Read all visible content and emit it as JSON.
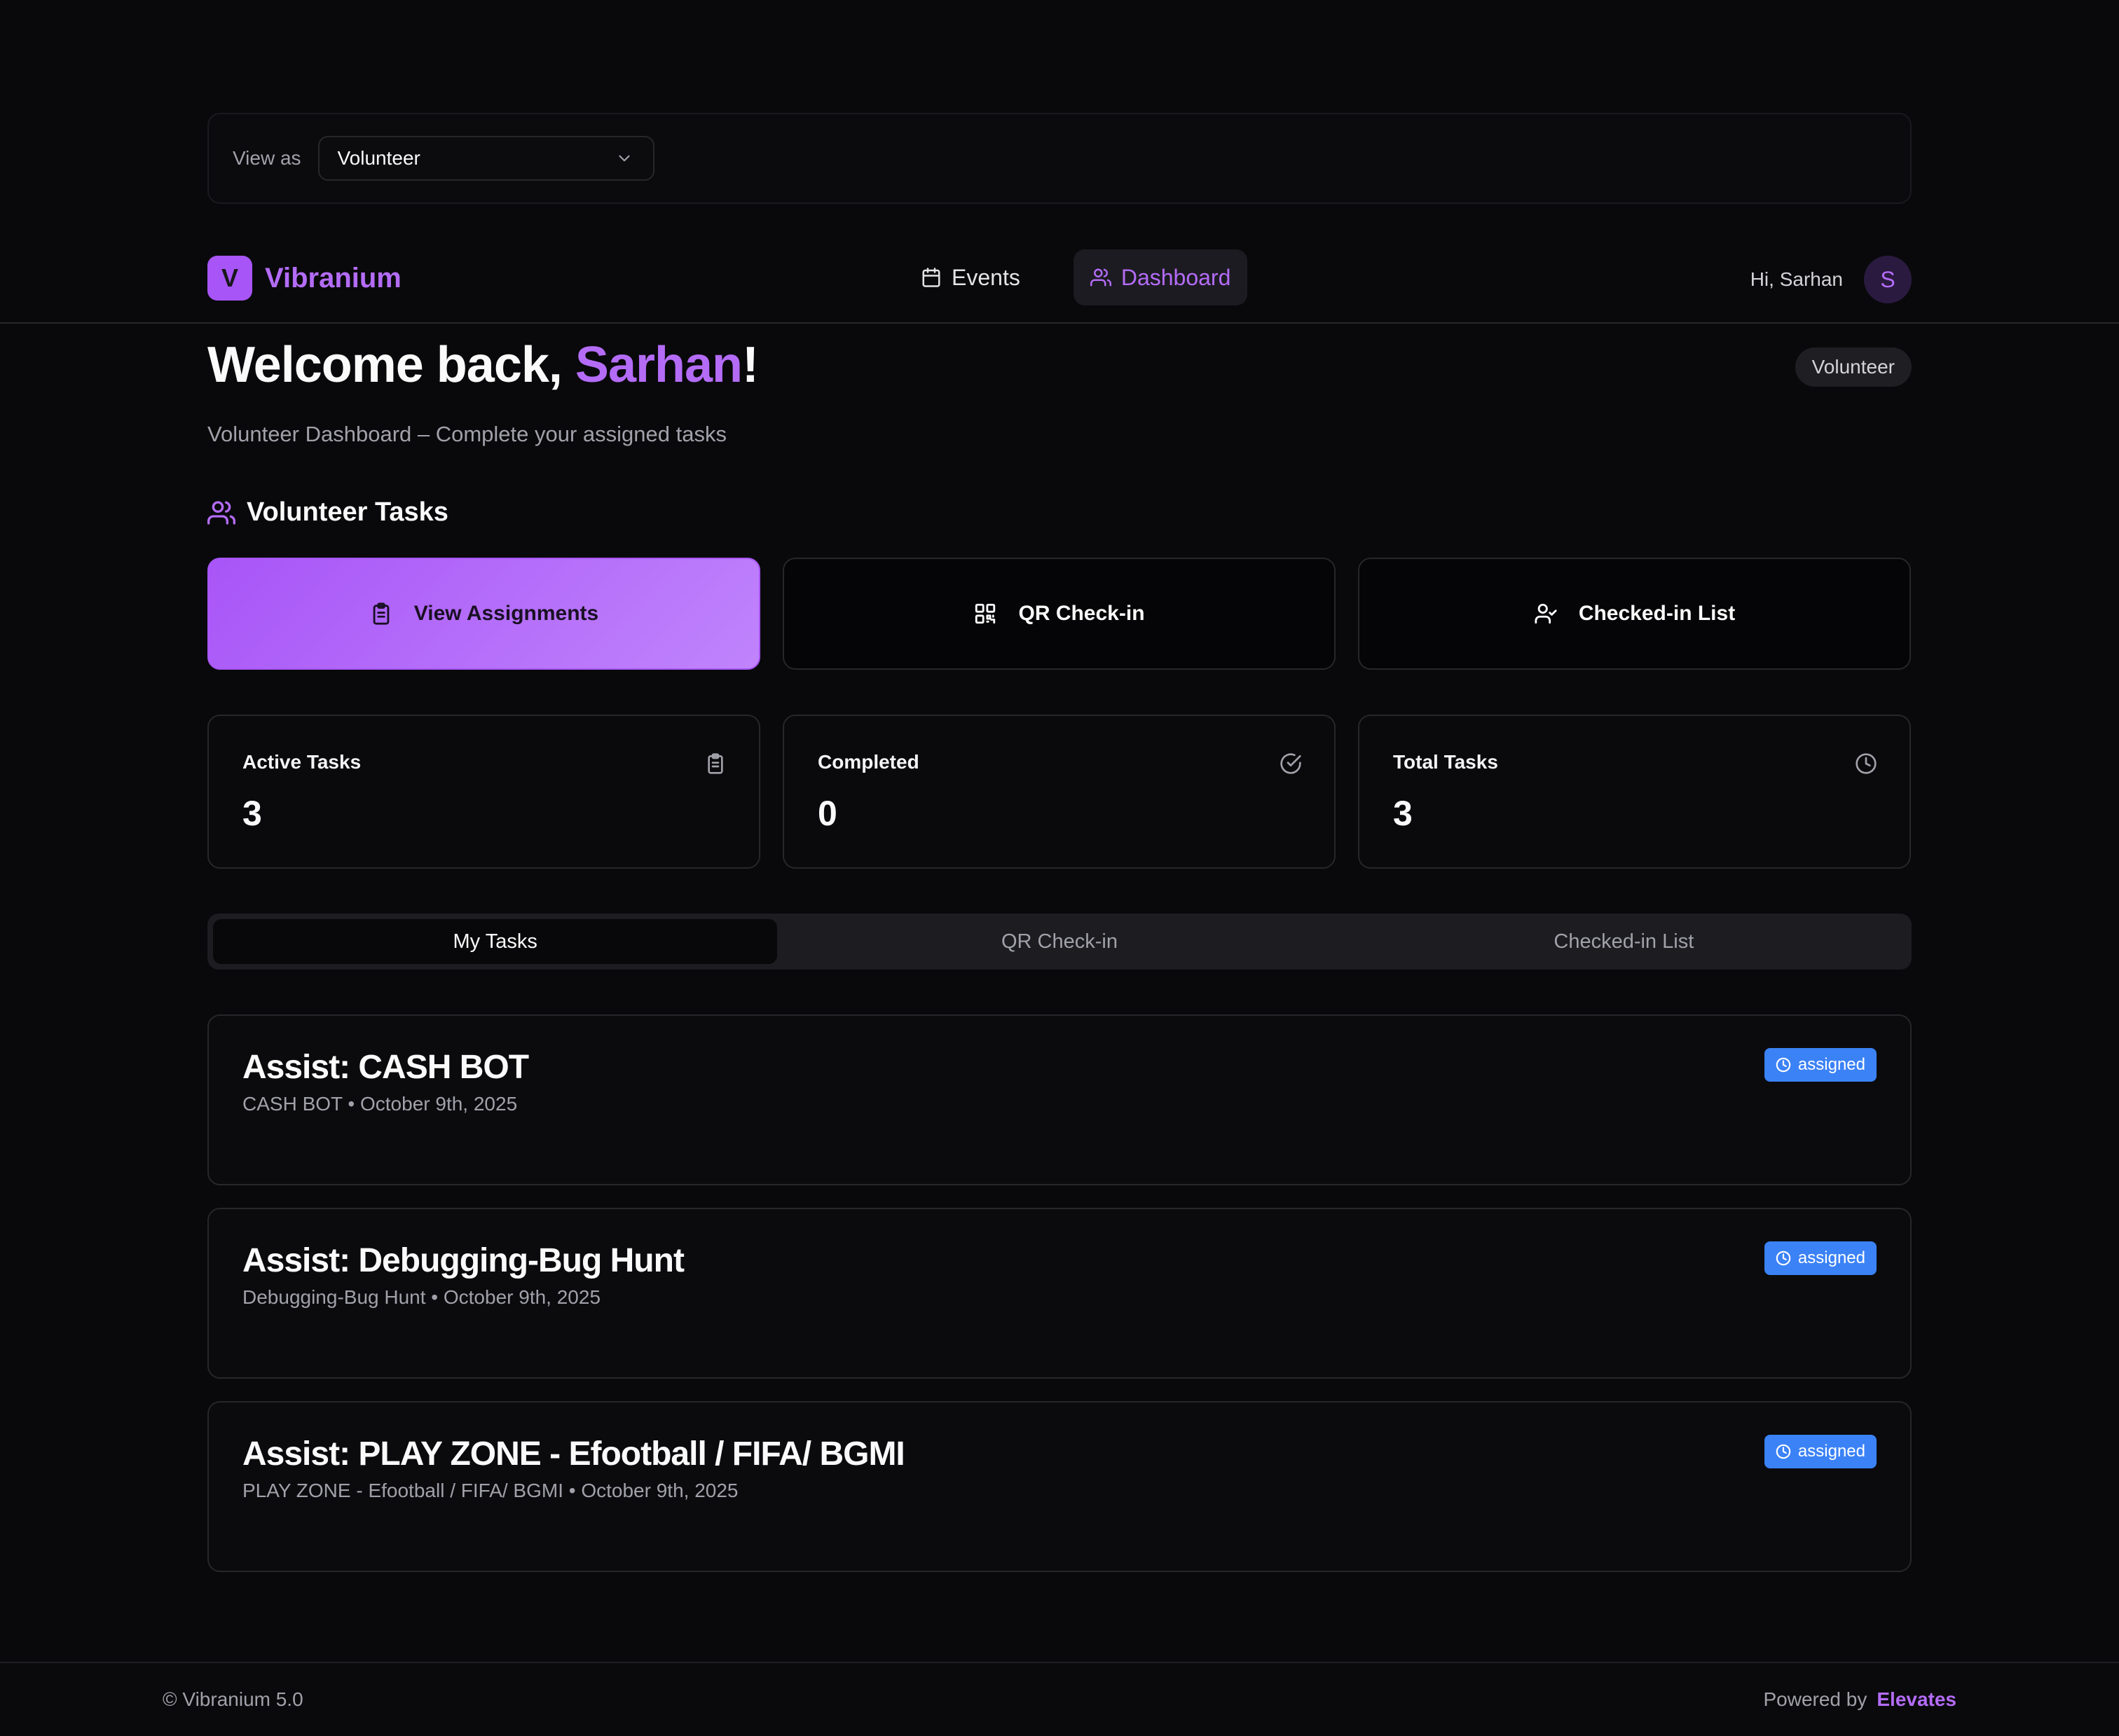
{
  "view_as": {
    "label": "View as",
    "selected": "Volunteer"
  },
  "header": {
    "logo_letter": "V",
    "logo_text": "Vibranium",
    "nav": [
      {
        "label": "Events",
        "icon": "calendar-icon"
      },
      {
        "label": "Dashboard",
        "icon": "users-icon",
        "active": true
      }
    ],
    "greeting": "Hi, Sarhan",
    "avatar_initial": "S"
  },
  "welcome": {
    "prefix": "Welcome back, ",
    "name": "Sarhan",
    "suffix": "!",
    "role": "Volunteer",
    "subtitle": "Volunteer Dashboard – Complete your assigned tasks"
  },
  "section": {
    "title": "Volunteer Tasks"
  },
  "actions": [
    {
      "label": "View Assignments",
      "icon": "clipboard-icon"
    },
    {
      "label": "QR Check-in",
      "icon": "qr-code-icon"
    },
    {
      "label": "Checked-in List",
      "icon": "user-check-icon"
    }
  ],
  "stats": [
    {
      "label": "Active Tasks",
      "value": "3",
      "icon": "clipboard-icon"
    },
    {
      "label": "Completed",
      "value": "0",
      "icon": "check-circle-icon"
    },
    {
      "label": "Total Tasks",
      "value": "3",
      "icon": "clock-icon"
    }
  ],
  "tabs": [
    {
      "label": "My Tasks",
      "active": true
    },
    {
      "label": "QR Check-in"
    },
    {
      "label": "Checked-in List"
    }
  ],
  "tasks": [
    {
      "title": "Assist: CASH BOT",
      "subtitle": "CASH BOT • October 9th, 2025",
      "status": "assigned"
    },
    {
      "title": "Assist: Debugging-Bug Hunt",
      "subtitle": "Debugging-Bug Hunt • October 9th, 2025",
      "status": "assigned"
    },
    {
      "title": "Assist: PLAY ZONE - Efootball / FIFA/ BGMI",
      "subtitle": "PLAY ZONE - Efootball / FIFA/ BGMI • October 9th, 2025",
      "status": "assigned"
    }
  ],
  "footer": {
    "copyright": "© Vibranium 5.0",
    "powered_by": "Powered by",
    "brand": "Elevates"
  },
  "colors": {
    "accent": "#a855f7",
    "badge": "#3b82f6",
    "background": "#09090b"
  }
}
